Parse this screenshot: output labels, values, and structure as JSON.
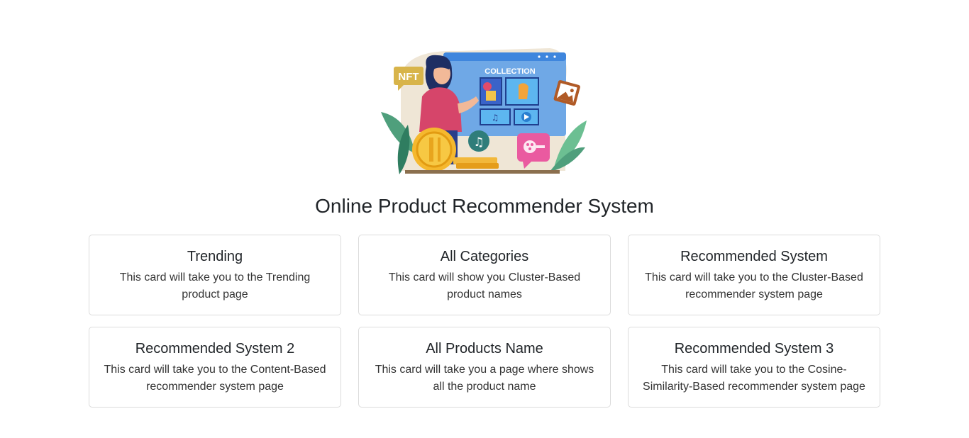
{
  "hero": {
    "badge_text": "NFT",
    "screen_heading": "COLLECTION"
  },
  "page": {
    "title": "Online Product Recommender System"
  },
  "cards": [
    {
      "title": "Trending",
      "text": "This card will take you to the Trending product page"
    },
    {
      "title": "All Categories",
      "text": "This card will show you Cluster-Based product names"
    },
    {
      "title": "Recommended System",
      "text": "This card will take you to the Cluster-Based recommender system page"
    },
    {
      "title": "Recommended System 2",
      "text": "This card will take you to the Content-Based recommender system page"
    },
    {
      "title": "All Products Name",
      "text": "This card will take you a page where shows all the product name"
    },
    {
      "title": "Recommended System 3",
      "text": "This card will take you to the Cosine-Similarity-Based recommender system page"
    }
  ],
  "colors": {
    "card_border": "#dcdcdc",
    "text": "#212529",
    "screen_blue": "#4a90e2",
    "coin_gold": "#f5b82e",
    "shirt_red": "#d6456a"
  }
}
